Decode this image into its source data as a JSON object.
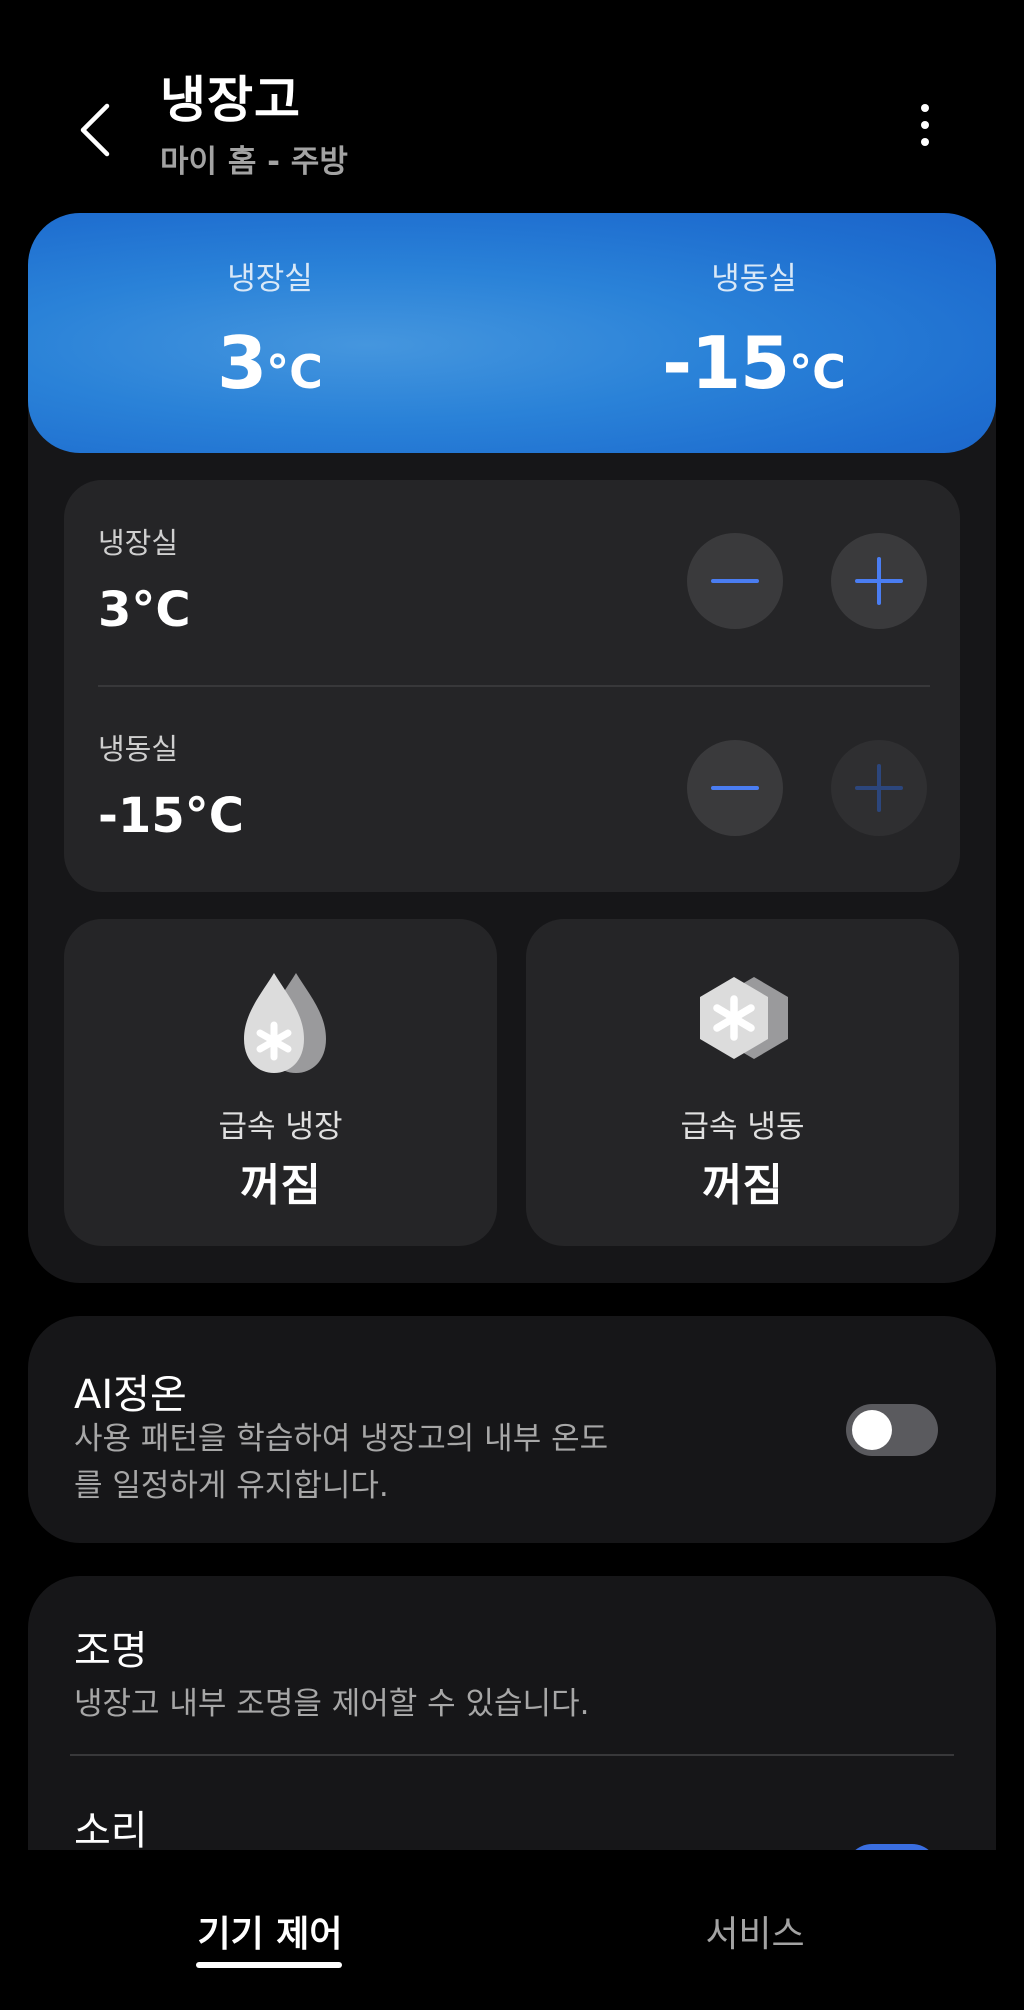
{
  "header": {
    "title": "냉장고",
    "subtitle": "마이 홈 - 주방"
  },
  "banner": {
    "fridge_label": "냉장실",
    "fridge_value": "3",
    "freezer_label": "냉동실",
    "freezer_value": "-15",
    "unit": "°C"
  },
  "controls": {
    "fridge_label": "냉장실",
    "fridge_value": "3°C",
    "freezer_label": "냉동실",
    "freezer_value": "-15°C"
  },
  "rapid": {
    "cool_label": "급속 냉장",
    "cool_state": "꺼짐",
    "freeze_label": "급속 냉동",
    "freeze_state": "꺼짐"
  },
  "ai": {
    "title": "AI정온",
    "description": "사용 패턴을 학습하여 냉장고의 내부 온도를 일정하게 유지합니다.",
    "enabled": false
  },
  "settings": {
    "light_title": "조명",
    "light_desc": "냉장고 내부 조명을 제어할 수 있습니다.",
    "sound_title": "소리"
  },
  "nav": {
    "tab_device": "기기 제어",
    "tab_service": "서비스"
  },
  "colors": {
    "accent_blue": "#4a7df2",
    "banner_blue": "#2a82d8"
  }
}
